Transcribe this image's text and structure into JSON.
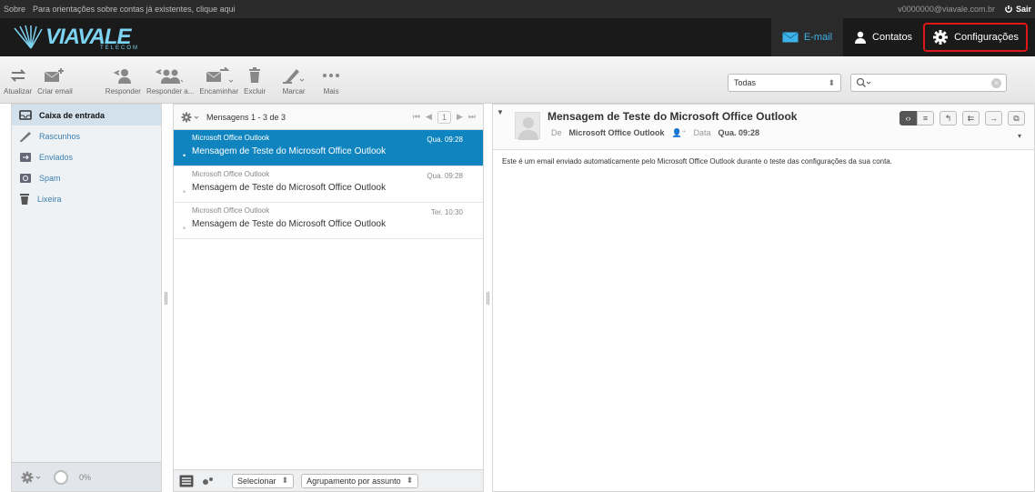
{
  "topbar": {
    "about": "Sobre",
    "notice": "Para orientações sobre contas já existentes, clique aqui",
    "user_email": "v0000000@viavale.com.br",
    "logout": "Sair"
  },
  "header": {
    "logo_text": "VIAVALE",
    "logo_sub": "TELECOM",
    "nav": {
      "email": "E-mail",
      "contacts": "Contatos",
      "settings": "Configurações"
    }
  },
  "toolbar": {
    "refresh": "Atualizar",
    "compose": "Criar email",
    "reply": "Responder",
    "reply_all": "Responder a...",
    "forward": "Encaminhar",
    "delete": "Excluir",
    "mark": "Marcar",
    "more": "Mais",
    "filter_value": "Todas"
  },
  "folders": [
    {
      "label": "Caixa de entrada",
      "icon": "inbox-icon"
    },
    {
      "label": "Rascunhos",
      "icon": "pencil-icon"
    },
    {
      "label": "Enviados",
      "icon": "sent-icon"
    },
    {
      "label": "Spam",
      "icon": "spam-icon"
    },
    {
      "label": "Lixeira",
      "icon": "trash-icon"
    }
  ],
  "quota": "0%",
  "msglist": {
    "summary": "Mensagens 1 - 3 de 3",
    "page": "1",
    "select_label": "Selecionar",
    "group_label": "Agrupamento por assunto",
    "messages": [
      {
        "from": "Microsoft Office Outlook",
        "date": "Qua. 09:28",
        "subject": "Mensagem de Teste do Microsoft Office Outlook"
      },
      {
        "from": "Microsoft Office Outlook",
        "date": "Qua. 09:28",
        "subject": "Mensagem de Teste do Microsoft Office Outlook"
      },
      {
        "from": "Microsoft Office Outlook",
        "date": "Ter. 10:30",
        "subject": "Mensagem de Teste do Microsoft Office Outlook"
      }
    ]
  },
  "preview": {
    "title": "Mensagem de Teste do Microsoft Office Outlook",
    "from_label": "De",
    "from": "Microsoft Office Outlook",
    "date_label": "Data",
    "date": "Qua. 09:28",
    "body": "Este é um email enviado automaticamente pelo Microsoft Office Outlook durante o teste das configurações da sua conta."
  },
  "colors": {
    "accent": "#0f84be",
    "highlight_border": "#e01717",
    "logo": "#7dd3f2"
  }
}
